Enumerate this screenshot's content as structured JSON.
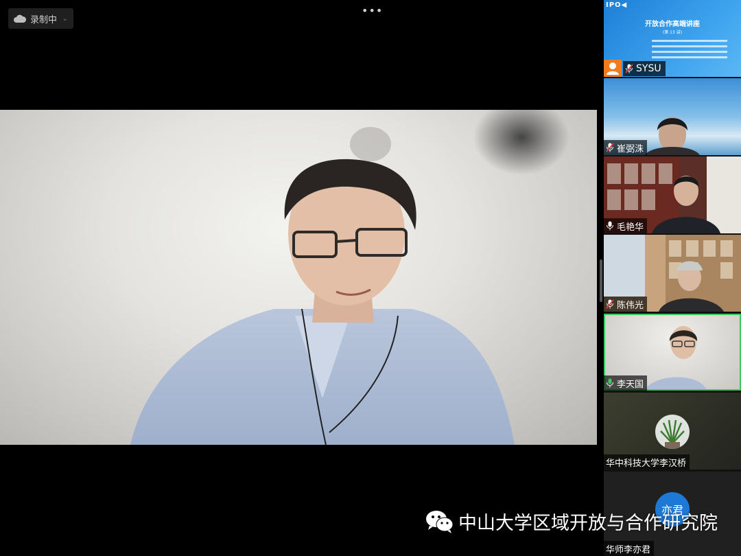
{
  "recording": {
    "label": "录制中",
    "icon": "cloud-icon"
  },
  "toolbar": {
    "more_label": "•••"
  },
  "main_speaker": {
    "name": "李天国"
  },
  "slide": {
    "logo": "IPO◀",
    "title": "开放合作高端讲座",
    "subtitle": "(第 13 讲)"
  },
  "gallery": {
    "sysu_label": "SYSU",
    "participants": [
      {
        "name": "崔弼洙",
        "muted": true
      },
      {
        "name": "毛艳华",
        "muted": false
      },
      {
        "name": "陈伟光",
        "muted": true
      },
      {
        "name": "李天国",
        "muted": false,
        "active": true
      },
      {
        "name": "华中科技大学李汉桥",
        "muted": null
      },
      {
        "name": "华师李亦君",
        "muted": null,
        "avatar_text": "亦君"
      }
    ]
  },
  "watermark": {
    "text": "中山大学区域开放与合作研究院"
  },
  "colors": {
    "active_border": "#3cc95c",
    "slide_blue": "#2b8fe3",
    "person_orange": "#f07c1f",
    "muted_red": "#e0433a"
  }
}
